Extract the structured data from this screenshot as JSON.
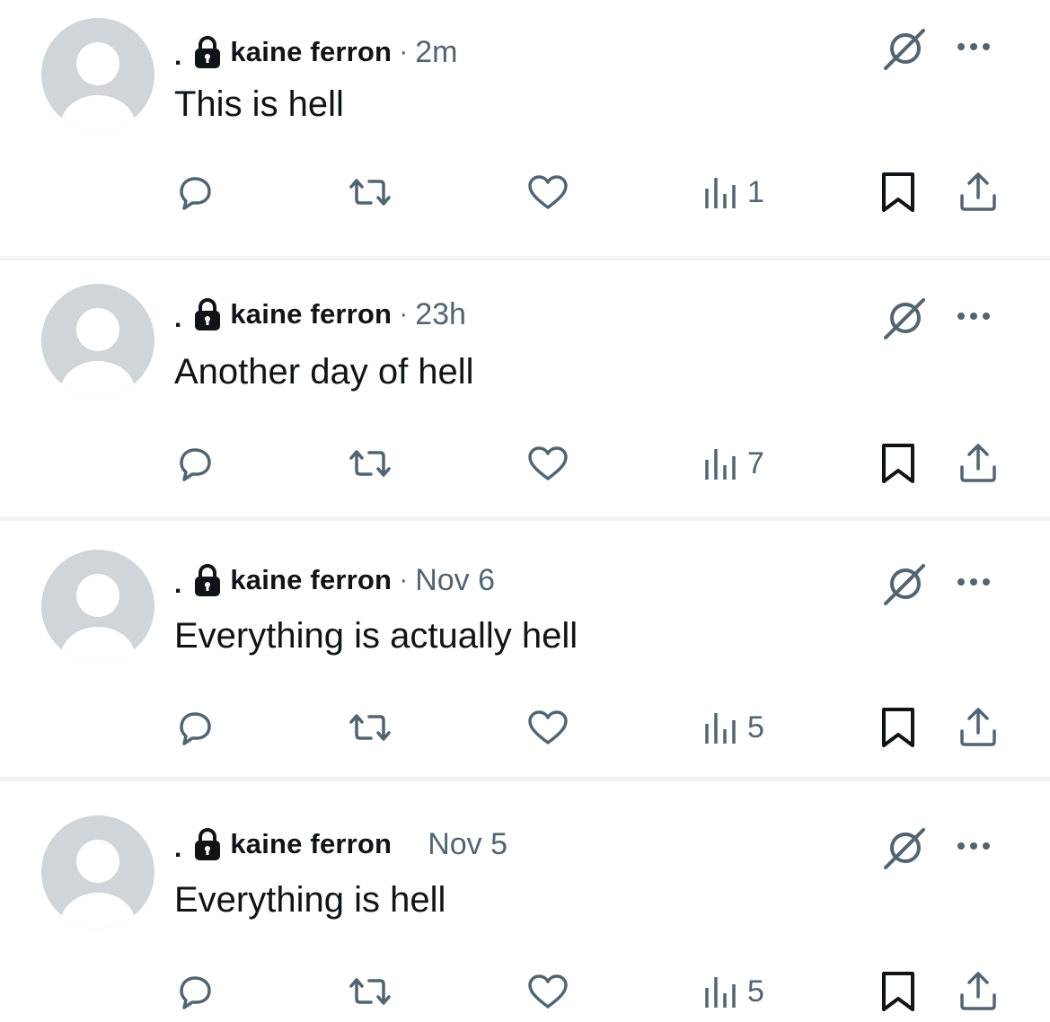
{
  "colors": {
    "text_primary": "#0f1419",
    "text_secondary": "#536471",
    "avatar_bg": "#cfd5d9",
    "divider": "#eff3f4"
  },
  "icons": {
    "lock": "lock-icon",
    "grok": "grok-icon",
    "more": "more-options-icon",
    "reply": "reply-icon",
    "repost": "repost-icon",
    "like": "like-icon",
    "views": "views-icon",
    "bookmark": "bookmark-icon",
    "share": "share-icon"
  },
  "posts": [
    {
      "marker": ".",
      "name": "kaine ferron",
      "separator": "·",
      "time": "2m",
      "text": "This is hell",
      "views": "1"
    },
    {
      "marker": ".",
      "name": "kaine ferron",
      "separator": "·",
      "time": "23h",
      "text": "Another day of hell",
      "views": "7"
    },
    {
      "marker": ".",
      "name": "kaine ferron",
      "separator": "·",
      "time": "Nov 6",
      "text": "Everything is actually hell",
      "views": "5"
    },
    {
      "marker": ".",
      "name": "kaine ferron",
      "separator": "",
      "time": "Nov 5",
      "text": "Everything is hell",
      "views": "5"
    }
  ]
}
